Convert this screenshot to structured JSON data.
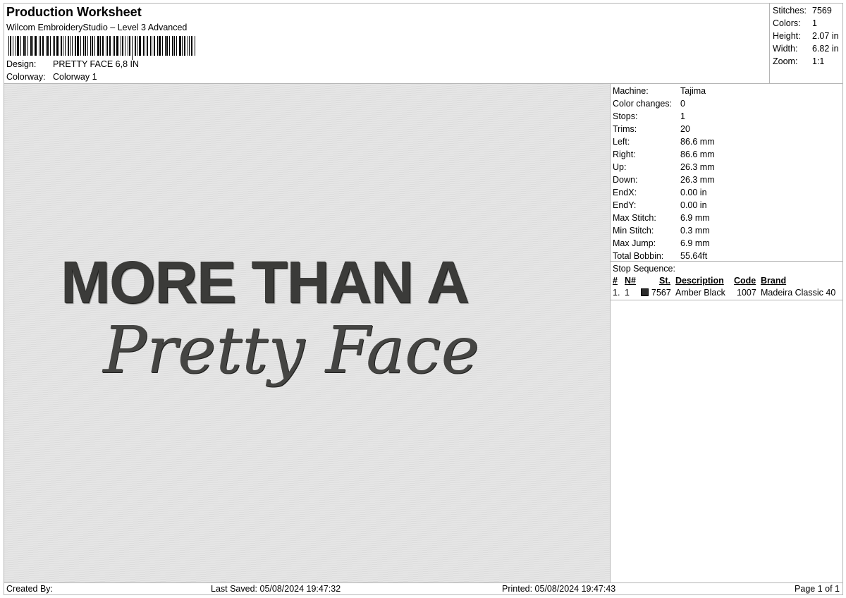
{
  "header": {
    "title": "Production Worksheet",
    "software": "Wilcom EmbroideryStudio – Level 3 Advanced",
    "design_label": "Design:",
    "design_value": "PRETTY FACE 6,8 IN",
    "colorway_label": "Colorway:",
    "colorway_value": "Colorway 1"
  },
  "stats": {
    "stitches_label": "Stitches:",
    "stitches": "7569",
    "colors_label": "Colors:",
    "colors": "1",
    "height_label": "Height:",
    "height": "2.07 in",
    "width_label": "Width:",
    "width": "6.82 in",
    "zoom_label": "Zoom:",
    "zoom": "1:1"
  },
  "preview": {
    "line1": "MORE THAN A",
    "line2": "Pretty Face"
  },
  "machine": {
    "machine_label": "Machine:",
    "machine": "Tajima",
    "color_changes_label": "Color changes:",
    "color_changes": "0",
    "stops_label": "Stops:",
    "stops": "1",
    "trims_label": "Trims:",
    "trims": "20",
    "left_label": "Left:",
    "left": "86.6 mm",
    "right_label": "Right:",
    "right": "86.6 mm",
    "up_label": "Up:",
    "up": "26.3 mm",
    "down_label": "Down:",
    "down": "26.3 mm",
    "endx_label": "EndX:",
    "endx": "0.00 in",
    "endy_label": "EndY:",
    "endy": "0.00 in",
    "max_stitch_label": "Max Stitch:",
    "max_stitch": "6.9 mm",
    "min_stitch_label": "Min Stitch:",
    "min_stitch": "0.3 mm",
    "max_jump_label": "Max Jump:",
    "max_jump": "6.9 mm",
    "total_bobbin_label": "Total Bobbin:",
    "total_bobbin": "55.64ft"
  },
  "stop_sequence": {
    "label": "Stop Sequence:",
    "columns": {
      "num": "#",
      "n": "N#",
      "st": "St.",
      "description": "Description",
      "code": "Code",
      "brand": "Brand"
    },
    "rows": [
      {
        "num": "1.",
        "n": "1",
        "color": "#2b2b2b",
        "st": "7567",
        "description": "Amber Black",
        "code": "1007",
        "brand": "Madeira Classic 40"
      }
    ]
  },
  "footer": {
    "created_by": "Created By:",
    "last_saved": "Last Saved: 05/08/2024 19:47:32",
    "printed": "Printed: 05/08/2024 19:47:43",
    "page": "Page 1 of 1"
  }
}
